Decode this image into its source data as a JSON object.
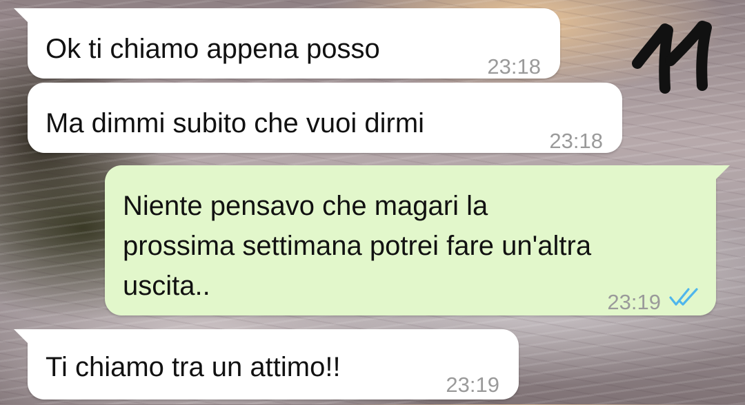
{
  "annotation": {
    "label": "11"
  },
  "messages": [
    {
      "direction": "incoming",
      "text": "Ok ti chiamo appena posso",
      "time": "23:18"
    },
    {
      "direction": "incoming",
      "text": "Ma dimmi subito che vuoi dirmi",
      "time": "23:18"
    },
    {
      "direction": "outgoing",
      "text": "Niente pensavo che magari la\nprossima settimana potrei fare un'altra\nuscita..",
      "time": "23:19",
      "status_icon": "double-check-read-icon"
    },
    {
      "direction": "incoming",
      "text": "Ti chiamo tra un attimo!!",
      "time": "23:19"
    }
  ],
  "colors": {
    "incoming_bubble": "#ffffff",
    "outgoing_bubble": "#e2f7cb",
    "timestamp": "#9a9a9a",
    "read_check": "#4fb6ec"
  }
}
